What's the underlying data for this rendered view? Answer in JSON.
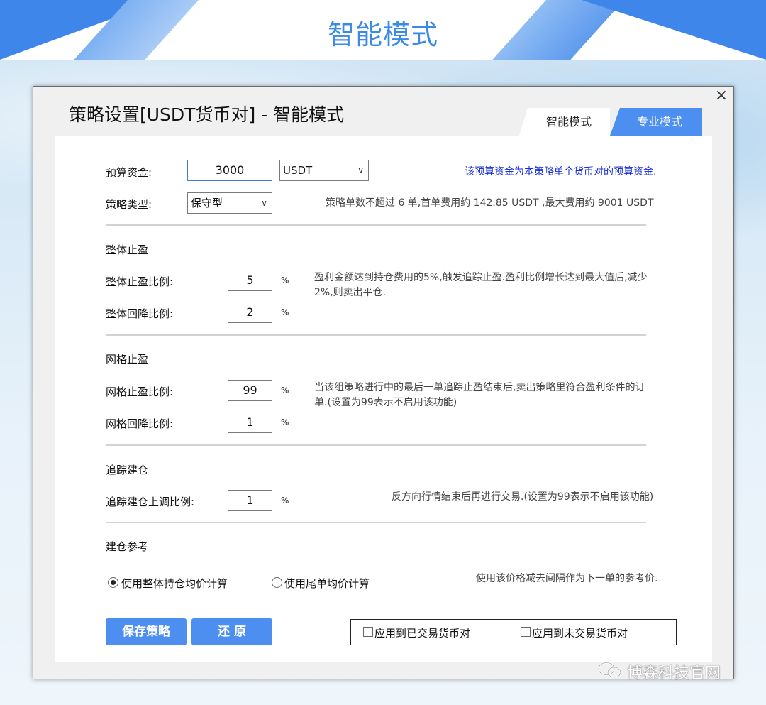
{
  "banner": {
    "title": "智能模式"
  },
  "dialog": {
    "title": "策略设置[USDT货币对] - 智能模式",
    "close_label": "×",
    "tabs": [
      {
        "label": "智能模式",
        "active": true
      },
      {
        "label": "专业模式",
        "active": false
      }
    ]
  },
  "budget": {
    "label": "预算资金:",
    "value": "3000",
    "currency": "USDT",
    "hint": "该预算资金为本策略单个货币对的预算资金."
  },
  "strategy_type": {
    "label": "策略类型:",
    "value": "保守型",
    "hint": "策略单数不超过 6 单,首单费用约 142.85 USDT ,最大费用约 9001 USDT"
  },
  "overall_take_profit": {
    "title": "整体止盈",
    "ratio_label": "整体止盈比例:",
    "ratio_value": "5",
    "pullback_label": "整体回降比例:",
    "pullback_value": "2",
    "unit": "%",
    "hint_line1": "盈利金额达到持仓费用的5%,触发追踪止盈.盈利比例增长达到最大值后,减少",
    "hint_line2": "2%,则卖出平仓."
  },
  "grid_take_profit": {
    "title": "网格止盈",
    "ratio_label": "网格止盈比例:",
    "ratio_value": "99",
    "pullback_label": "网格回降比例:",
    "pullback_value": "1",
    "unit": "%",
    "hint_line1": "当该组策略进行中的最后一单追踪止盈结束后,卖出策略里符合盈利条件的订",
    "hint_line2": "单.(设置为99表示不启用该功能)"
  },
  "trailing_entry": {
    "title": "追踪建仓",
    "ratio_label": "追踪建仓上调比例:",
    "ratio_value": "1",
    "unit": "%",
    "hint": "反方向行情结束后再进行交易.(设置为99表示不启用该功能)"
  },
  "entry_reference": {
    "title": "建仓参考",
    "option_avg": "使用整体持仓均价计算",
    "option_last": "使用尾单均价计算",
    "selected": "使用整体持仓均价计算",
    "hint": "使用该价格减去间隔作为下一单的参考价."
  },
  "actions": {
    "save_label": "保存策略",
    "reset_label": "还 原",
    "apply_traded": "应用到已交易货币对",
    "apply_untraded": "应用到未交易货币对"
  },
  "watermark": {
    "text": "博森科技官网",
    "icon": "wechat-icon"
  },
  "colors": {
    "accent": "#4c8ff0",
    "hint_blue": "#1a2fd6",
    "banner_title": "#3b8ae6"
  }
}
